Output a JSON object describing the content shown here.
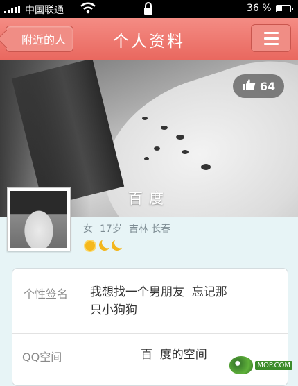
{
  "status_bar": {
    "carrier": "中国联通",
    "battery": "36 %"
  },
  "nav": {
    "back_label": "附近的人",
    "title": "个人资料",
    "menu_icon": "hamburger-menu-icon"
  },
  "cover": {
    "likes": "64",
    "like_icon": "thumbs-up-icon",
    "name": "百度"
  },
  "profile": {
    "gender": "女",
    "age": "17岁",
    "province": "吉林",
    "city": "长春",
    "level_icons": [
      "sun-icon",
      "moon-icon",
      "moon-icon"
    ]
  },
  "details": {
    "signature_label": "个性签名",
    "signature_line1": "我想找一个男朋友  忘记那",
    "signature_line2": "只小狗狗",
    "qzone_label": "QQ空间",
    "qzone_value": "百  度的空间"
  },
  "watermark": {
    "text": "MOP.COM"
  },
  "colors": {
    "nav_bar": "#ec726a",
    "background": "#e7f4f6",
    "level_icon": "#f5b81c"
  }
}
